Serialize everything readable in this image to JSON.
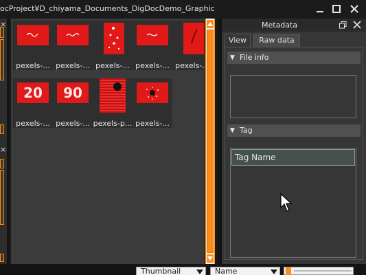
{
  "window": {
    "title": "ocProject¥D_chiyama_Documents_DigDocDemo_Graphic",
    "minimize_icon": "minimize-icon",
    "maximize_icon": "maximize-icon",
    "close_icon": "close-icon"
  },
  "thumbnails": [
    {
      "label": "pexels-...",
      "image": "red-white-script"
    },
    {
      "label": "pexels-...",
      "image": "red-white-script"
    },
    {
      "label": "pexels-...",
      "image": "red-dots-portrait"
    },
    {
      "label": "pexels-...",
      "image": "red-white-script"
    },
    {
      "label": "pexels-...",
      "image": "red-stroke-portrait"
    },
    {
      "label": "pexels-...",
      "image": "red-number",
      "number": "20"
    },
    {
      "label": "pexels-...",
      "image": "red-number",
      "number": "90"
    },
    {
      "label": "pexels-p...",
      "image": "red-stripes-black-dot"
    },
    {
      "label": "pexels-...",
      "image": "red-black-dot"
    }
  ],
  "metadata_panel": {
    "title": "Metadata",
    "float_icon": "float-panel-icon",
    "close_icon": "close-icon",
    "tabs": [
      {
        "label": "View",
        "active": true
      },
      {
        "label": "Raw data",
        "active": false
      }
    ],
    "sections": {
      "file_info": {
        "label": "File info",
        "expanded": true
      },
      "tag": {
        "label": "Tag",
        "expanded": true,
        "column_header": "Tag Name"
      }
    }
  },
  "bottom_bar": {
    "view_mode": "Thumbnail",
    "sort_by": "Name"
  },
  "colors": {
    "accent": "#ff8c1a",
    "panel": "#363636",
    "background": "#141414",
    "thumb_red": "#e11919"
  }
}
